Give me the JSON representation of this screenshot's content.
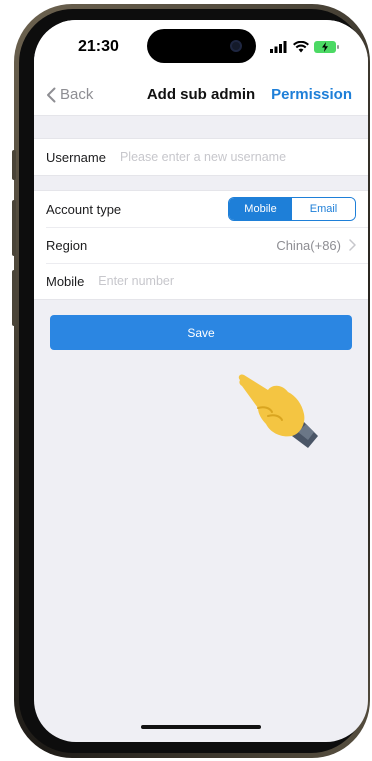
{
  "status_bar": {
    "time": "21:30",
    "icons": [
      "signal-icon",
      "wifi-icon",
      "battery-charging-icon"
    ]
  },
  "nav": {
    "back_label": "Back",
    "title": "Add sub admin",
    "permission_label": "Permission"
  },
  "form": {
    "username": {
      "label": "Username",
      "value": "",
      "placeholder": "Please enter a new username"
    },
    "account_type": {
      "label": "Account type",
      "options": [
        "Mobile",
        "Email"
      ],
      "selected": "Mobile"
    },
    "region": {
      "label": "Region",
      "value": "China(+86)"
    },
    "mobile": {
      "label": "Mobile",
      "value": "",
      "placeholder": "Enter number"
    }
  },
  "save_label": "Save",
  "colors": {
    "accent": "#1e7fd8",
    "button": "#2b86e2",
    "background": "#efeff4"
  }
}
